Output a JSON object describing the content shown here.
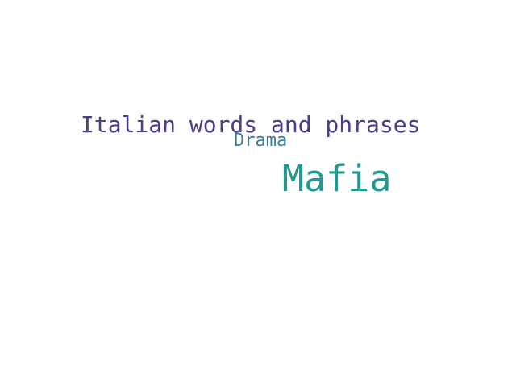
{
  "words": [
    {
      "text": "Italian words and phrases",
      "color": "#483d8b"
    },
    {
      "text": "Drama",
      "color": "#3b7a99"
    },
    {
      "text": "Mafia",
      "color": "#21998c"
    }
  ]
}
